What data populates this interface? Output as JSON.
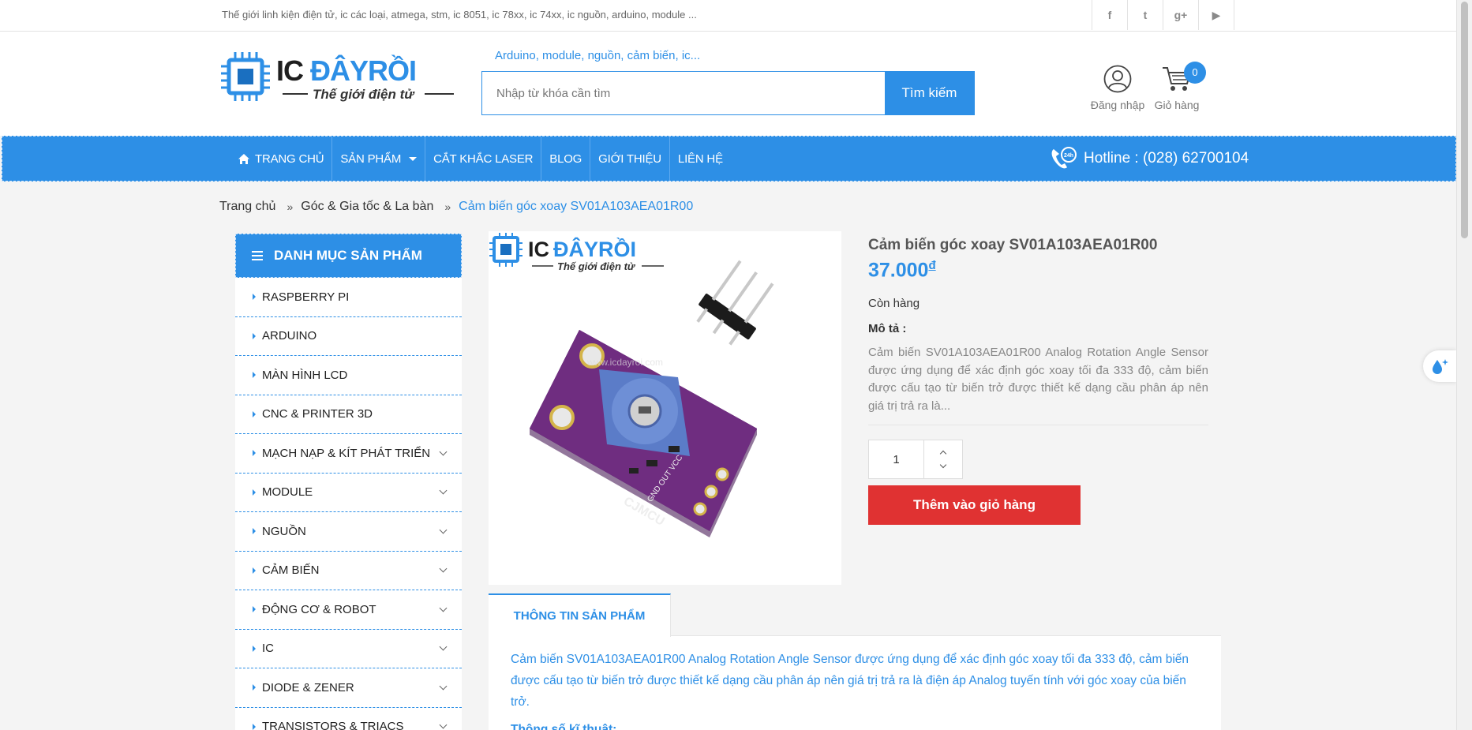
{
  "topbar": {
    "tagline": "Thế giới linh kiện điện tử, ic các loại, atmega, stm, ic 8051, ic 78xx, ic 74xx, ic nguồn, arduino, module ...",
    "social": [
      {
        "icon": "facebook-icon",
        "glyph": "f"
      },
      {
        "icon": "twitter-icon",
        "glyph": "t"
      },
      {
        "icon": "google-plus-icon",
        "glyph": "g+"
      },
      {
        "icon": "youtube-icon",
        "glyph": "▶"
      }
    ]
  },
  "header": {
    "logo_text": "ICĐÂYRỒI",
    "logo_tagline": "Thế giới điện tử",
    "search_hint": "Arduino, module, nguồn, cảm biến, ic...",
    "search_placeholder": "Nhập từ khóa cần tìm",
    "search_button": "Tìm kiếm",
    "login_label": "Đăng nhập",
    "cart_label": "Giỏ hàng",
    "cart_count": "0"
  },
  "nav": {
    "items": [
      "TRANG CHỦ",
      "SẢN PHẨM",
      "CẮT KHẮC LASER",
      "BLOG",
      "GIỚI THIỆU",
      "LIÊN HỆ"
    ],
    "hotline": "Hotline : (028) 62700104",
    "hotline_badge": "24h"
  },
  "breadcrumb": {
    "items": [
      "Trang chủ",
      "Góc & Gia tốc & La bàn",
      "Cảm biến góc xoay SV01A103AEA01R00"
    ]
  },
  "sidebar": {
    "title": "DANH MỤC SẢN PHẨM",
    "items": [
      {
        "label": "RASPBERRY PI",
        "expandable": false
      },
      {
        "label": "ARDUINO",
        "expandable": false
      },
      {
        "label": "MÀN HÌNH LCD",
        "expandable": false
      },
      {
        "label": "CNC & PRINTER 3D",
        "expandable": false
      },
      {
        "label": "MẠCH NẠP & KÍT PHÁT TRIỂN",
        "expandable": true
      },
      {
        "label": "MODULE",
        "expandable": true
      },
      {
        "label": "NGUỒN",
        "expandable": true
      },
      {
        "label": "CẢM BIẾN",
        "expandable": true
      },
      {
        "label": "ĐỘNG CƠ & ROBOT",
        "expandable": true
      },
      {
        "label": "IC",
        "expandable": true
      },
      {
        "label": "DIODE & ZENER",
        "expandable": true
      },
      {
        "label": "TRANSISTORS & TRIACS",
        "expandable": true
      }
    ]
  },
  "product": {
    "title": "Cảm biến góc xoay SV01A103AEA01R00",
    "price": "37.000",
    "currency": "đ",
    "stock": "Còn hàng",
    "desc_label": "Mô tả :",
    "desc": "Cảm biến SV01A103AEA01R00 Analog Rotation Angle Sensor được ứng dụng để xác định góc xoay tối đa 333 độ, cảm biến được cấu tạo từ biến trở được thiết kế dạng cầu phân áp nên giá trị trả ra là...",
    "quantity": "1",
    "add_to_cart": "Thêm vào giỏ hàng",
    "image_board_label": "CJMCU",
    "image_pins_label": "GND OUT VCC",
    "image_watermark": "www.icdayroi.com"
  },
  "tabs": {
    "active": "THÔNG TIN SẢN PHẨM",
    "body": "Cảm biến SV01A103AEA01R00 Analog Rotation Angle Sensor được ứng dụng để xác định góc xoay tối đa 333 độ, cảm biến được cấu tạo từ biến trở được thiết kế dạng cầu phân áp nên giá trị trả ra là điện áp Analog tuyến tính với góc xoay của biến trở.",
    "next_heading": "Thông số kĩ thuật:"
  },
  "colors": {
    "brand_blue": "#2d8fe6",
    "add_cart_red": "#e03232",
    "background": "#f4f4f4"
  }
}
